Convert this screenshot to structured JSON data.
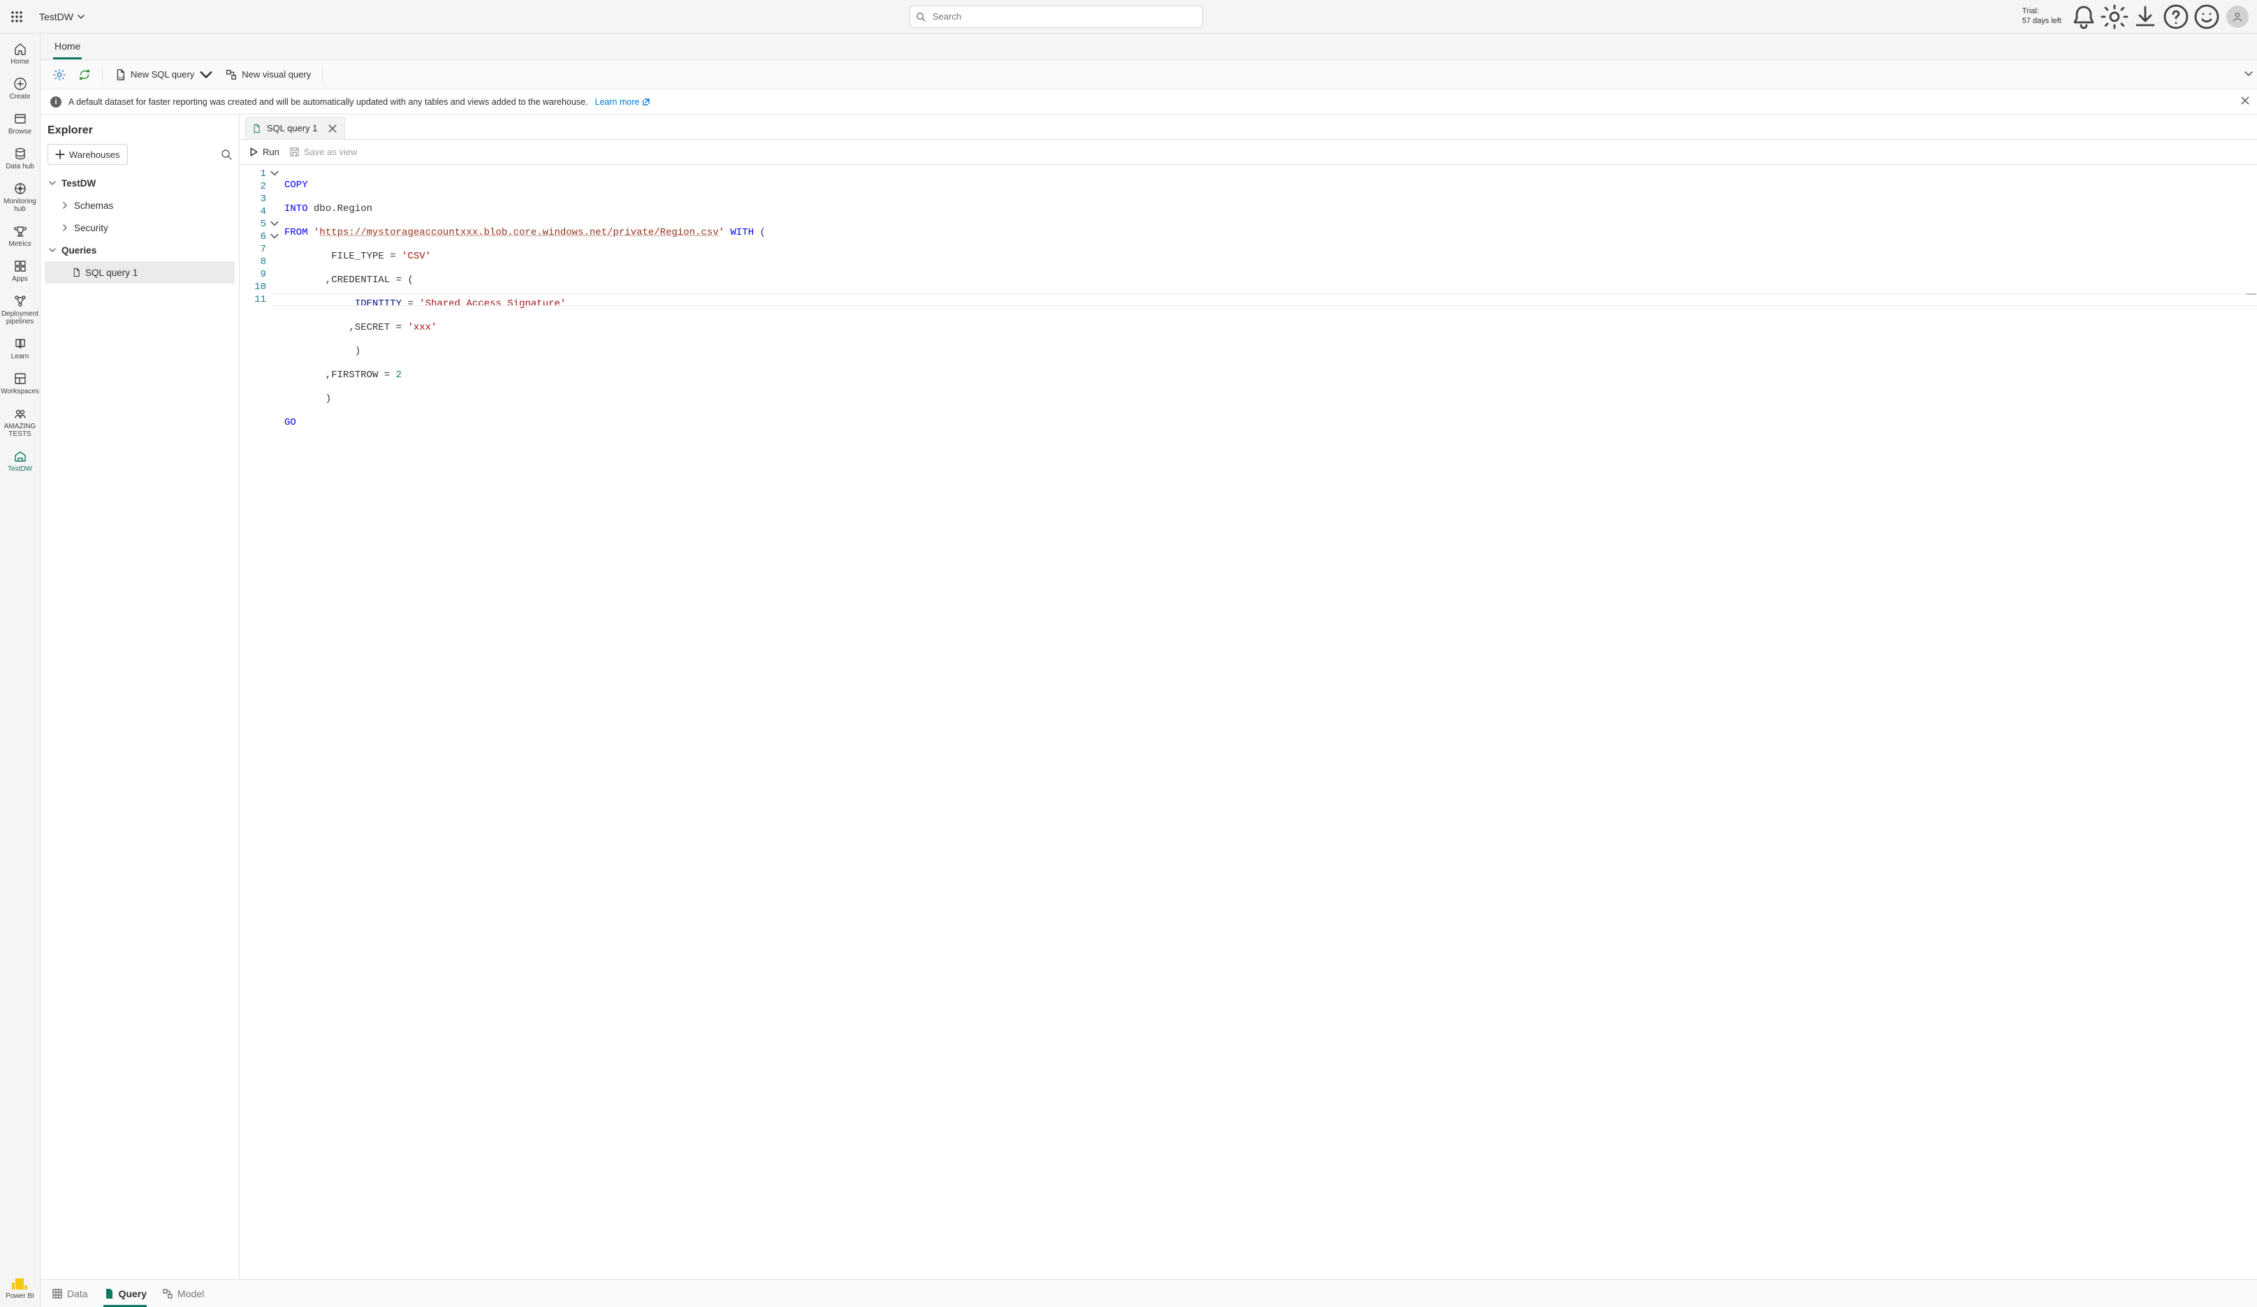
{
  "top": {
    "workspace_name": "TestDW",
    "search_placeholder": "Search",
    "trial_line1": "Trial:",
    "trial_line2": "57 days left"
  },
  "rail": {
    "items": [
      {
        "key": "home",
        "label": "Home"
      },
      {
        "key": "create",
        "label": "Create"
      },
      {
        "key": "browse",
        "label": "Browse"
      },
      {
        "key": "datahub",
        "label": "Data hub"
      },
      {
        "key": "monitoring",
        "label": "Monitoring hub"
      },
      {
        "key": "metrics",
        "label": "Metrics"
      },
      {
        "key": "apps",
        "label": "Apps"
      },
      {
        "key": "pipelines",
        "label": "Deployment pipelines"
      },
      {
        "key": "learn",
        "label": "Learn"
      },
      {
        "key": "workspaces",
        "label": "Workspaces"
      },
      {
        "key": "amazing",
        "label": "AMAZING TESTS"
      },
      {
        "key": "testdw",
        "label": "TestDW"
      }
    ],
    "footer_label": "Power BI"
  },
  "ribbon": {
    "tab_home": "Home",
    "new_sql_query": "New SQL query",
    "new_visual_query": "New visual query"
  },
  "info": {
    "message": "A default dataset for faster reporting was created and will be automatically updated with any tables and views added to the warehouse.",
    "link_text": "Learn more"
  },
  "explorer": {
    "title": "Explorer",
    "warehouses_btn": "Warehouses",
    "nodes": {
      "root": "TestDW",
      "schemas": "Schemas",
      "security": "Security",
      "queries": "Queries",
      "query1": "SQL query 1"
    }
  },
  "editor": {
    "tab_label": "SQL query 1",
    "run_label": "Run",
    "save_view_label": "Save as view",
    "code": {
      "l1_copy": "COPY",
      "l2_into": "INTO",
      "l2_target": " dbo.Region",
      "l3_from": "FROM",
      "l3_q1": " '",
      "l3_url": "https://mystorageaccountxxx.blob.core.windows.net/private/Region.csv",
      "l3_q2": "'",
      "l3_with": " WITH",
      "l3_paren": " (",
      "l4_pre": "        FILE_TYPE = ",
      "l4_val": "'CSV'",
      "l5_pre": "       ,CREDENTIAL = (",
      "l6_pre": "            ",
      "l6_ident": "IDENTITY",
      "l6_eq": " = ",
      "l6_val": "'Shared Access Signature'",
      "l7_pre": "           ,SECRET = ",
      "l7_val": "'xxx'",
      "l8": "            )",
      "l9_pre": "       ,FIRSTROW = ",
      "l9_val": "2",
      "l10": "       )",
      "l11": "GO"
    }
  },
  "bottom": {
    "data": "Data",
    "query": "Query",
    "model": "Model"
  }
}
